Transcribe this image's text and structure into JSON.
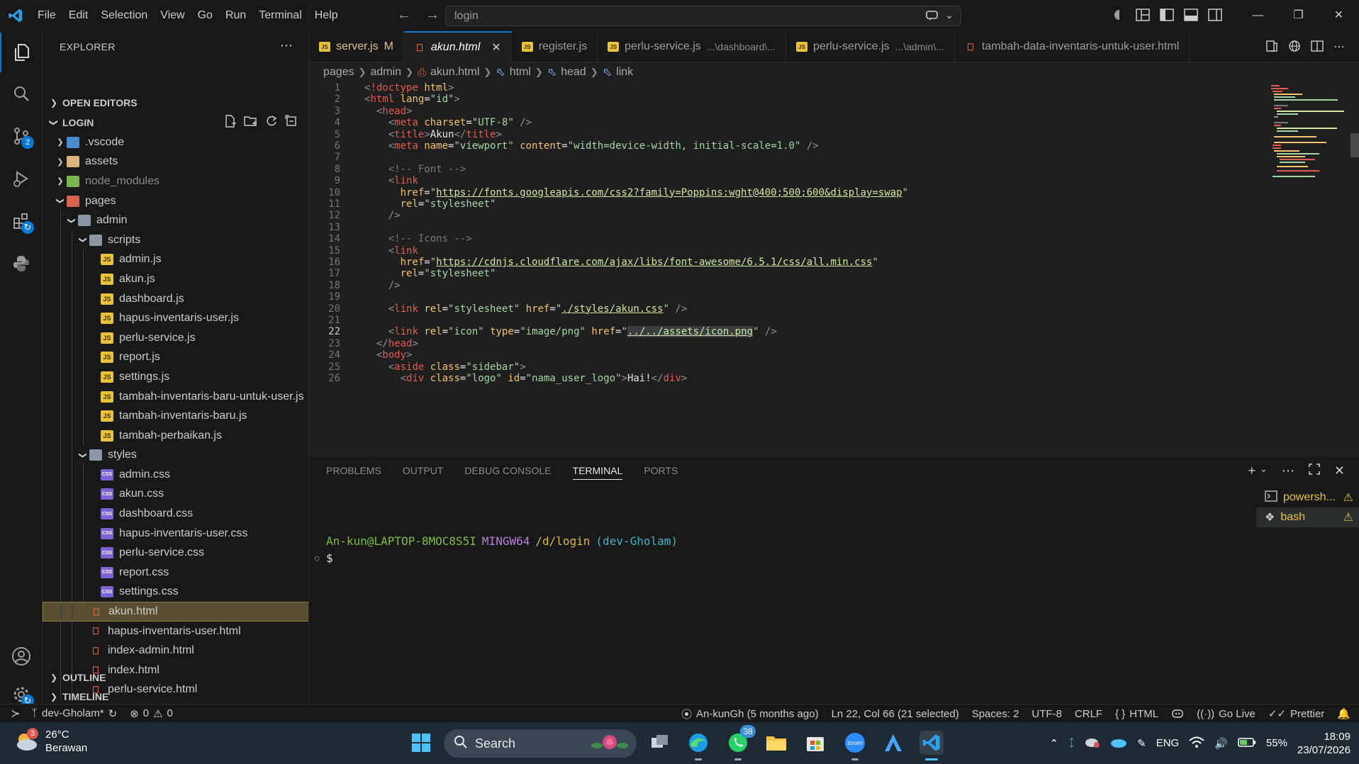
{
  "titlebar": {
    "menu": [
      "File",
      "Edit",
      "Selection",
      "View",
      "Go",
      "Run",
      "Terminal",
      "Help"
    ],
    "search_text": "login",
    "window_controls": [
      "minimize",
      "maximize",
      "close"
    ]
  },
  "activitybar": {
    "items": [
      "explorer-icon",
      "search-icon",
      "source-control-icon",
      "run-debug-icon",
      "extensions-icon",
      "python-icon"
    ],
    "source_control_badge": "2",
    "bottom": [
      "accounts-icon",
      "settings-icon"
    ]
  },
  "sidebar": {
    "title": "EXPLORER",
    "open_editors": "OPEN EDITORS",
    "workspace": "LOGIN",
    "outline": "OUTLINE",
    "timeline": "TIMELINE",
    "tree": [
      {
        "label": ".vscode",
        "type": "folder-blue",
        "depth": 0,
        "state": "collapsed"
      },
      {
        "label": "assets",
        "type": "folder",
        "depth": 0,
        "state": "collapsed"
      },
      {
        "label": "node_modules",
        "type": "folder-green",
        "depth": 0,
        "state": "collapsed",
        "dim": true
      },
      {
        "label": "pages",
        "type": "folder-red",
        "depth": 0,
        "state": "expanded"
      },
      {
        "label": "admin",
        "type": "folder-gray",
        "depth": 1,
        "state": "expanded"
      },
      {
        "label": "scripts",
        "type": "folder-gray",
        "depth": 2,
        "state": "expanded"
      },
      {
        "label": "admin.js",
        "type": "js",
        "depth": 3
      },
      {
        "label": "akun.js",
        "type": "js",
        "depth": 3
      },
      {
        "label": "dashboard.js",
        "type": "js",
        "depth": 3
      },
      {
        "label": "hapus-inventaris-user.js",
        "type": "js",
        "depth": 3
      },
      {
        "label": "perlu-service.js",
        "type": "js",
        "depth": 3
      },
      {
        "label": "report.js",
        "type": "js",
        "depth": 3
      },
      {
        "label": "settings.js",
        "type": "js",
        "depth": 3
      },
      {
        "label": "tambah-inventaris-baru-untuk-user.js",
        "type": "js",
        "depth": 3
      },
      {
        "label": "tambah-inventaris-baru.js",
        "type": "js",
        "depth": 3
      },
      {
        "label": "tambah-perbaikan.js",
        "type": "js",
        "depth": 3
      },
      {
        "label": "styles",
        "type": "folder-gray",
        "depth": 2,
        "state": "expanded"
      },
      {
        "label": "admin.css",
        "type": "css",
        "depth": 3
      },
      {
        "label": "akun.css",
        "type": "css",
        "depth": 3
      },
      {
        "label": "dashboard.css",
        "type": "css",
        "depth": 3
      },
      {
        "label": "hapus-inventaris-user.css",
        "type": "css",
        "depth": 3
      },
      {
        "label": "perlu-service.css",
        "type": "css",
        "depth": 3
      },
      {
        "label": "report.css",
        "type": "css",
        "depth": 3
      },
      {
        "label": "settings.css",
        "type": "css",
        "depth": 3
      },
      {
        "label": "akun.html",
        "type": "html",
        "depth": 2,
        "selected": true
      },
      {
        "label": "hapus-inventaris-user.html",
        "type": "html",
        "depth": 2
      },
      {
        "label": "index-admin.html",
        "type": "html",
        "depth": 2
      },
      {
        "label": "index.html",
        "type": "html",
        "depth": 2
      },
      {
        "label": "perlu-service.html",
        "type": "html",
        "depth": 2
      }
    ]
  },
  "tabs": [
    {
      "label": "server.js",
      "type": "js",
      "modified": "M",
      "desc": ""
    },
    {
      "label": "akun.html",
      "type": "html",
      "active": true,
      "desc": ""
    },
    {
      "label": "register.js",
      "type": "js",
      "desc": ""
    },
    {
      "label": "perlu-service.js",
      "type": "js",
      "desc": "...\\dashboard\\..."
    },
    {
      "label": "perlu-service.js",
      "type": "js",
      "desc": "...\\admin\\..."
    },
    {
      "label": "tambah-data-inventaris-untuk-user.html",
      "type": "html",
      "desc": ""
    }
  ],
  "breadcrumb": [
    "pages",
    "admin",
    "akun.html",
    "html",
    "head",
    "link"
  ],
  "editor": {
    "current_line": 22,
    "lines": [
      [
        [
          "br",
          "<"
        ],
        [
          "tag",
          "!doctype"
        ],
        [
          "txt",
          " "
        ],
        [
          "attr",
          "html"
        ],
        [
          "br",
          ">"
        ]
      ],
      [
        [
          "br",
          "<"
        ],
        [
          "tag",
          "html"
        ],
        [
          "txt",
          " "
        ],
        [
          "attr",
          "lang"
        ],
        [
          "txt",
          "="
        ],
        [
          "str",
          "\"id\""
        ],
        [
          "br",
          ">"
        ]
      ],
      [
        [
          "txt",
          "  "
        ],
        [
          "br",
          "<"
        ],
        [
          "tag",
          "head"
        ],
        [
          "br",
          ">"
        ]
      ],
      [
        [
          "txt",
          "    "
        ],
        [
          "br",
          "<"
        ],
        [
          "tag",
          "meta"
        ],
        [
          "txt",
          " "
        ],
        [
          "attr",
          "charset"
        ],
        [
          "txt",
          "="
        ],
        [
          "str",
          "\"UTF-8\""
        ],
        [
          "txt",
          " "
        ],
        [
          "br",
          "/>"
        ]
      ],
      [
        [
          "txt",
          "    "
        ],
        [
          "br",
          "<"
        ],
        [
          "tag",
          "title"
        ],
        [
          "br",
          ">"
        ],
        [
          "txt",
          "Akun"
        ],
        [
          "br",
          "</"
        ],
        [
          "tag",
          "title"
        ],
        [
          "br",
          ">"
        ]
      ],
      [
        [
          "txt",
          "    "
        ],
        [
          "br",
          "<"
        ],
        [
          "tag",
          "meta"
        ],
        [
          "txt",
          " "
        ],
        [
          "attr",
          "name"
        ],
        [
          "txt",
          "="
        ],
        [
          "str",
          "\"viewport\""
        ],
        [
          "txt",
          " "
        ],
        [
          "attr",
          "content"
        ],
        [
          "txt",
          "="
        ],
        [
          "str",
          "\"width=device-width, initial-scale=1.0\""
        ],
        [
          "txt",
          " "
        ],
        [
          "br",
          "/>"
        ]
      ],
      [],
      [
        [
          "txt",
          "    "
        ],
        [
          "com",
          "<!-- Font -->"
        ]
      ],
      [
        [
          "txt",
          "    "
        ],
        [
          "br",
          "<"
        ],
        [
          "tag",
          "link"
        ]
      ],
      [
        [
          "txt",
          "      "
        ],
        [
          "attr",
          "href"
        ],
        [
          "txt",
          "="
        ],
        [
          "str",
          "\""
        ],
        [
          "url",
          "https://fonts.googleapis.com/css2?family=Poppins:wght@400;500;600&display=swap"
        ],
        [
          "str",
          "\""
        ]
      ],
      [
        [
          "txt",
          "      "
        ],
        [
          "attr",
          "rel"
        ],
        [
          "txt",
          "="
        ],
        [
          "str",
          "\"stylesheet\""
        ]
      ],
      [
        [
          "txt",
          "    "
        ],
        [
          "br",
          "/>"
        ]
      ],
      [],
      [
        [
          "txt",
          "    "
        ],
        [
          "com",
          "<!-- Icons -->"
        ]
      ],
      [
        [
          "txt",
          "    "
        ],
        [
          "br",
          "<"
        ],
        [
          "tag",
          "link"
        ]
      ],
      [
        [
          "txt",
          "      "
        ],
        [
          "attr",
          "href"
        ],
        [
          "txt",
          "="
        ],
        [
          "str",
          "\""
        ],
        [
          "url",
          "https://cdnjs.cloudflare.com/ajax/libs/font-awesome/6.5.1/css/all.min.css"
        ],
        [
          "str",
          "\""
        ]
      ],
      [
        [
          "txt",
          "      "
        ],
        [
          "attr",
          "rel"
        ],
        [
          "txt",
          "="
        ],
        [
          "str",
          "\"stylesheet\""
        ]
      ],
      [
        [
          "txt",
          "    "
        ],
        [
          "br",
          "/>"
        ]
      ],
      [],
      [
        [
          "txt",
          "    "
        ],
        [
          "br",
          "<"
        ],
        [
          "tag",
          "link"
        ],
        [
          "txt",
          " "
        ],
        [
          "attr",
          "rel"
        ],
        [
          "txt",
          "="
        ],
        [
          "str",
          "\"stylesheet\""
        ],
        [
          "txt",
          " "
        ],
        [
          "attr",
          "href"
        ],
        [
          "txt",
          "="
        ],
        [
          "str",
          "\""
        ],
        [
          "url",
          "./styles/akun.css"
        ],
        [
          "str",
          "\""
        ],
        [
          "txt",
          " "
        ],
        [
          "br",
          "/>"
        ]
      ],
      [],
      [
        [
          "txt",
          "    "
        ],
        [
          "br",
          "<"
        ],
        [
          "tag",
          "link"
        ],
        [
          "txt",
          " "
        ],
        [
          "attr",
          "rel"
        ],
        [
          "txt",
          "="
        ],
        [
          "str",
          "\"icon\""
        ],
        [
          "txt",
          " "
        ],
        [
          "attr",
          "type"
        ],
        [
          "txt",
          "="
        ],
        [
          "str",
          "\"image/png\""
        ],
        [
          "txt",
          " "
        ],
        [
          "attr",
          "href"
        ],
        [
          "txt",
          "="
        ],
        [
          "str",
          "\""
        ],
        [
          "url",
          "../../assets/icon.png"
        ],
        [
          "str",
          "\""
        ],
        [
          "txt",
          " "
        ],
        [
          "br",
          "/>"
        ]
      ],
      [
        [
          "txt",
          "  "
        ],
        [
          "br",
          "</"
        ],
        [
          "tag",
          "head"
        ],
        [
          "br",
          ">"
        ]
      ],
      [
        [
          "txt",
          "  "
        ],
        [
          "br",
          "<"
        ],
        [
          "tag",
          "body"
        ],
        [
          "br",
          ">"
        ]
      ],
      [
        [
          "txt",
          "    "
        ],
        [
          "br",
          "<"
        ],
        [
          "tag",
          "aside"
        ],
        [
          "txt",
          " "
        ],
        [
          "attr",
          "class"
        ],
        [
          "txt",
          "="
        ],
        [
          "str",
          "\"sidebar\""
        ],
        [
          "br",
          ">"
        ]
      ],
      [
        [
          "txt",
          "      "
        ],
        [
          "br",
          "<"
        ],
        [
          "tag",
          "div"
        ],
        [
          "txt",
          " "
        ],
        [
          "attr",
          "class"
        ],
        [
          "txt",
          "="
        ],
        [
          "str",
          "\"logo\""
        ],
        [
          "txt",
          " "
        ],
        [
          "attr",
          "id"
        ],
        [
          "txt",
          "="
        ],
        [
          "str",
          "\"nama_user_logo\""
        ],
        [
          "br",
          ">"
        ],
        [
          "txt",
          "Hai!"
        ],
        [
          "br",
          "</"
        ],
        [
          "tag",
          "div"
        ],
        [
          "br",
          ">"
        ]
      ]
    ]
  },
  "panel": {
    "tabs": [
      "PROBLEMS",
      "OUTPUT",
      "DEBUG CONSOLE",
      "TERMINAL",
      "PORTS"
    ],
    "active_tab": "TERMINAL",
    "terminals": [
      {
        "label": "powersh...",
        "icon": "terminal-icon"
      },
      {
        "label": "bash",
        "icon": "bash-icon",
        "active": true
      }
    ],
    "prompt_user": "An-kun@LAPTOP-8MOC8S5I",
    "prompt_host": "MINGW64",
    "prompt_path": "/d/login",
    "prompt_branch": "(dev-Gholam)",
    "prompt_symbol": "$"
  },
  "statusbar": {
    "branch": "dev-Gholam*",
    "errors": "0",
    "warnings": "0",
    "blame": "An-kunGh (5 months ago)",
    "position": "Ln 22, Col 66 (21 selected)",
    "spaces": "Spaces: 2",
    "encoding": "UTF-8",
    "eol": "CRLF",
    "language": "HTML",
    "golive": "Go Live",
    "prettier": "Prettier"
  },
  "taskbar": {
    "temperature": "26°C",
    "weather": "Berawan",
    "weather_badge": "3",
    "search_label": "Search",
    "whatsapp_badge": "38",
    "lang": "ENG",
    "battery": "55%",
    "time": "18:09",
    "date": "23/07/2026"
  },
  "colors": {
    "accent": "#0078d4",
    "selection": "#5a4f30",
    "js": "#e8c33a",
    "css": "#7d62d6",
    "html": "#e66a35"
  }
}
